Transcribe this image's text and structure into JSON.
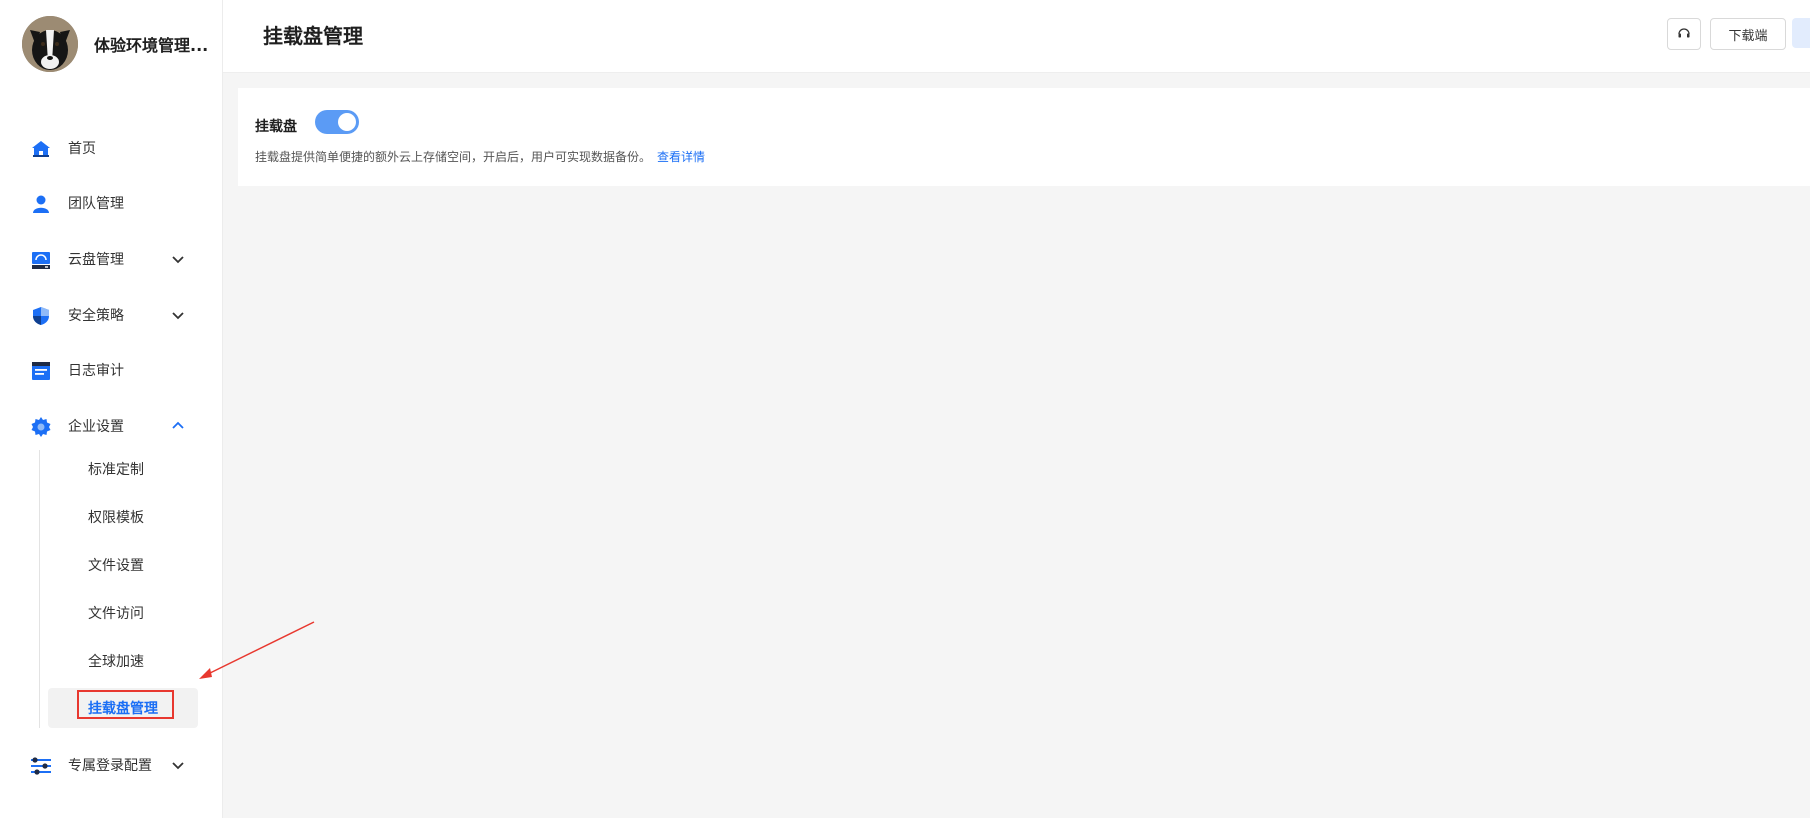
{
  "brand": {
    "name": "体验环境管理..."
  },
  "nav": {
    "items": [
      {
        "label": "首页",
        "icon": "home-icon"
      },
      {
        "label": "团队管理",
        "icon": "user-icon"
      },
      {
        "label": "云盘管理",
        "icon": "cloud-drive-icon",
        "expandable": true
      },
      {
        "label": "安全策略",
        "icon": "shield-icon",
        "expandable": true
      },
      {
        "label": "日志审计",
        "icon": "log-icon"
      },
      {
        "label": "企业设置",
        "icon": "gear-icon",
        "expandable": true,
        "expanded": true
      },
      {
        "label": "专属登录配置",
        "icon": "sliders-icon",
        "expandable": true
      }
    ],
    "sub_items": [
      {
        "label": "标准定制"
      },
      {
        "label": "权限模板"
      },
      {
        "label": "文件设置"
      },
      {
        "label": "文件访问"
      },
      {
        "label": "全球加速"
      },
      {
        "label": "挂载盘管理",
        "active": true
      }
    ]
  },
  "header": {
    "title": "挂载盘管理",
    "support_icon": "headset-icon",
    "download_label": "下载端"
  },
  "mount_card": {
    "title": "挂载盘",
    "toggle_on": true,
    "description": "挂载盘提供简单便捷的额外云上存储空间，开启后，用户可实现数据备份。",
    "link": "查看详情"
  },
  "colors": {
    "accent": "#1c6ff5",
    "toggle": "#5b9bf5",
    "annotation": "#e8382f"
  }
}
